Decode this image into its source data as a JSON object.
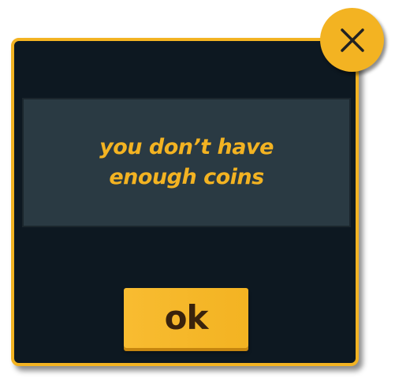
{
  "dialog": {
    "message": "you don’t have enough coins",
    "ok_label": "ok",
    "close_icon": "close-icon"
  },
  "colors": {
    "accent": "#f3b322",
    "dialog_background": "#0d1821",
    "panel_background": "#2a3a43",
    "button_text": "#3a230c"
  }
}
